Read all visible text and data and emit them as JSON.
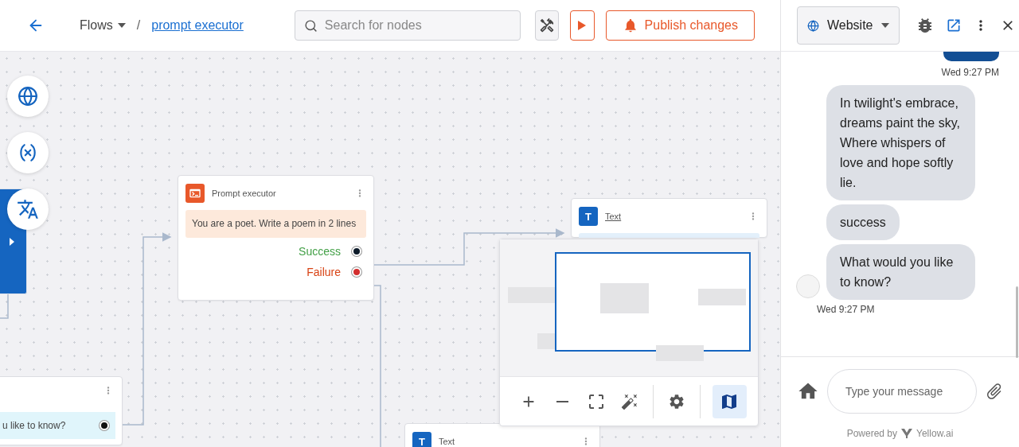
{
  "topbar": {
    "breadcrumb": "Flows",
    "separator": "/",
    "current": "prompt executor",
    "search": {
      "placeholder": "Search for nodes"
    },
    "publish": "Publish changes"
  },
  "canvas": {
    "side_tools": [
      {
        "kind": "globe"
      },
      {
        "kind": "variable"
      },
      {
        "kind": "translate"
      }
    ],
    "nodes": [
      {
        "kind": "prompt",
        "title": "Prompt executor",
        "body": "You are a poet. Write a poem in 2 lines",
        "outputs": [
          {
            "label": "Success",
            "kind": "success"
          },
          {
            "label": "Failure",
            "kind": "failure"
          }
        ]
      },
      {
        "kind": "text",
        "title": "Text",
        "icon_letter": "T"
      },
      {
        "kind": "text",
        "title": "Text",
        "icon_letter": "T"
      },
      {
        "kind": "question",
        "body": "u like to know?"
      }
    ],
    "minimap": {
      "tools": [
        {
          "kind": "zoom-in",
          "selected": false
        },
        {
          "kind": "zoom-out",
          "selected": false
        },
        {
          "kind": "fit",
          "selected": false
        },
        {
          "kind": "magic",
          "selected": false
        },
        {
          "kind": "settings",
          "selected": false
        },
        {
          "kind": "map",
          "selected": true
        }
      ]
    }
  },
  "chat": {
    "channel": "Website",
    "top_time": "Wed 9:27 PM",
    "messages": [
      {
        "text": "In twilight's embrace, dreams paint the sky, Where whispers of love and hope softly lie."
      },
      {
        "text": "success"
      },
      {
        "text": "What would you like to know?"
      }
    ],
    "bottom_time": "Wed 9:27 PM",
    "input": {
      "placeholder": "Type your message"
    },
    "powered_by": "Powered by",
    "brand": "Yellow.ai"
  }
}
